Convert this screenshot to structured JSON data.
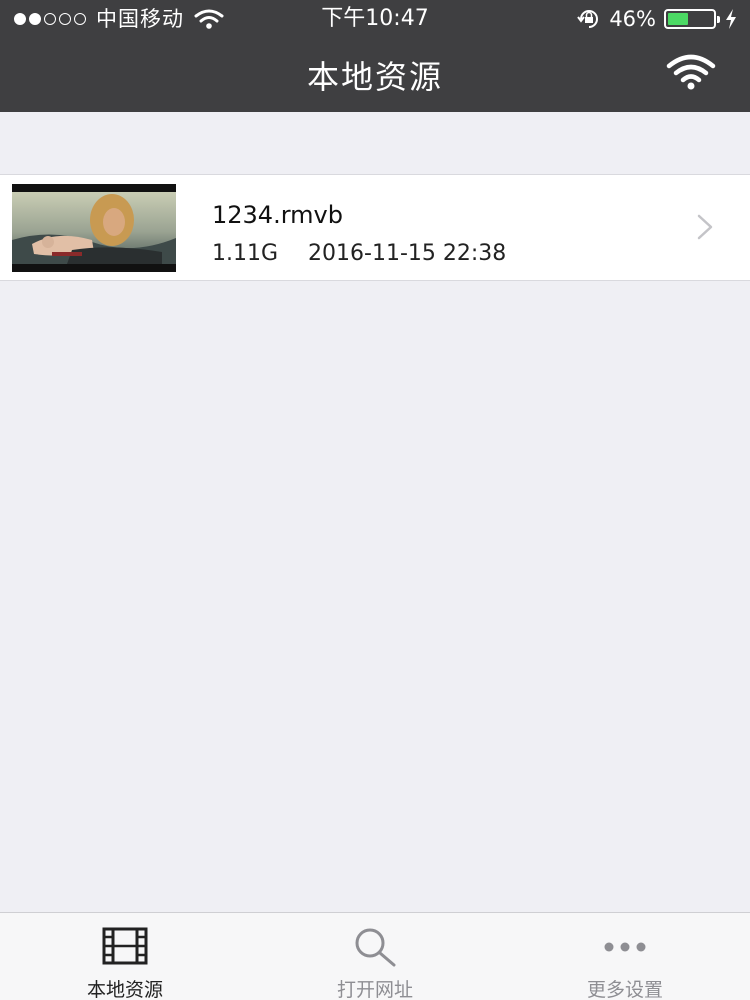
{
  "status_bar": {
    "carrier": "中国移动",
    "time": "下午10:47",
    "battery_percent_text": "46%",
    "battery_level": 0.46,
    "battery_color": "#4cd964"
  },
  "nav": {
    "title": "本地资源",
    "right_icon": "wifi-icon"
  },
  "files": [
    {
      "name": "1234.rmvb",
      "size": "1.11G",
      "date": "2016-11-15 22:38",
      "thumbnail_icon": "video-thumbnail"
    }
  ],
  "tabs": [
    {
      "label": "本地资源",
      "icon": "film-icon",
      "active": true
    },
    {
      "label": "打开网址",
      "icon": "search-icon",
      "active": false
    },
    {
      "label": "更多设置",
      "icon": "more-icon",
      "active": false
    }
  ],
  "colors": {
    "header_bg": "#3f3f41",
    "page_bg": "#efeff4",
    "tab_active": "#222222",
    "tab_inactive": "#8e8e93"
  }
}
